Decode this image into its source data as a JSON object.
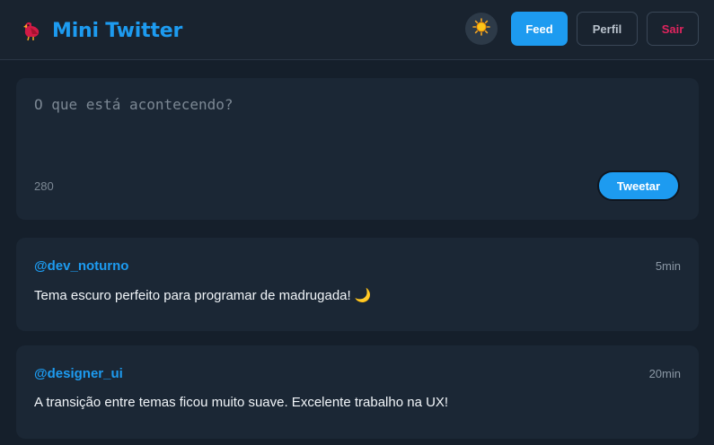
{
  "header": {
    "title": "Mini Twitter",
    "theme_toggle_icon": "sun-icon",
    "nav": {
      "feed_label": "Feed",
      "perfil_label": "Perfil",
      "sair_label": "Sair"
    }
  },
  "composer": {
    "placeholder": "O que está acontecendo?",
    "value": "",
    "char_count": "280",
    "submit_label": "Tweetar"
  },
  "posts": [
    {
      "user": "@dev_noturno",
      "time": "5min",
      "text": "Tema escuro perfeito para programar de madrugada! 🌙"
    },
    {
      "user": "@designer_ui",
      "time": "20min",
      "text": "A transição entre temas ficou muito suave. Excelente trabalho na UX!"
    }
  ],
  "colors": {
    "accent": "#1d9bf0",
    "danger": "#e0245e",
    "background": "#151f2b",
    "card": "#1b2735"
  }
}
